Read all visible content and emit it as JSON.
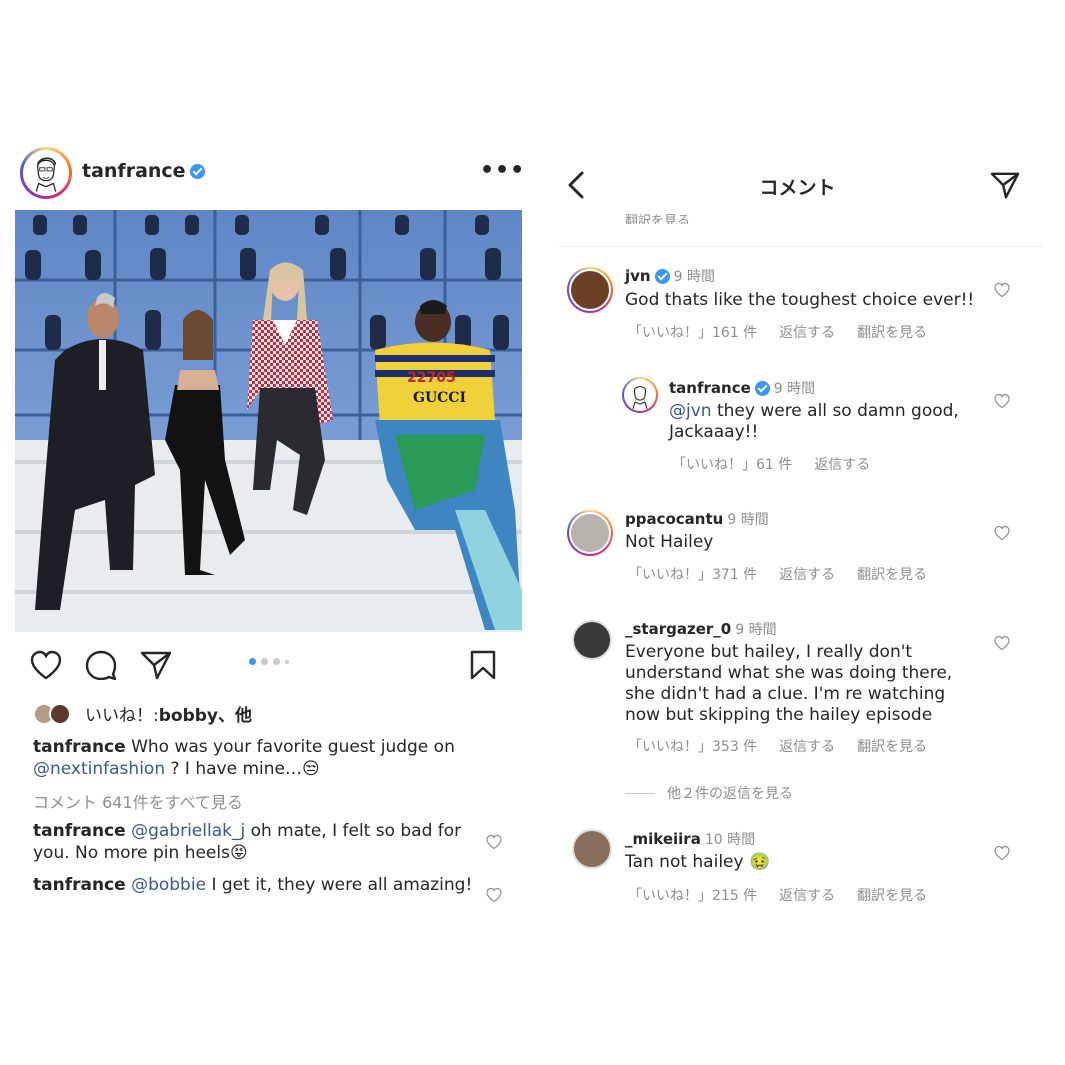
{
  "post": {
    "username": "tanfrance",
    "likes_prefix": "いいね！: ",
    "likes_label": "bobby、他",
    "caption_text": " Who was your favorite guest judge on ",
    "caption_mention": "@nextinfashion",
    "caption_tail": " ? I have mine…😒",
    "view_all": "コメント 641件をすべて見る",
    "comments": [
      {
        "user": "tanfrance",
        "mention": "@gabriellak_j",
        "text": " oh mate, I felt so bad for you. No more pin heels😝"
      },
      {
        "user": "tanfrance",
        "mention": "@bobbie",
        "text": " I get it, they were all amazing!"
      }
    ]
  },
  "comments_screen": {
    "title": "コメント",
    "truncated": "翻訳を見る",
    "more_replies": "他２件の返信を見る",
    "items": [
      {
        "user": "jvn",
        "time": "9 時間",
        "text": "God thats like the toughest choice ever!!",
        "likes": "「いいね！」161 件",
        "reply": "返信する",
        "translate": "翻訳を見る"
      },
      {
        "user": "tanfrance",
        "time": "9 時間",
        "mention": "@jvn",
        "text": " they were all so damn good, Jackaaay!!",
        "likes": "「いいね！」61 件",
        "reply": "返信する"
      },
      {
        "user": "ppacocantu",
        "time": "9 時間",
        "text": "Not Hailey",
        "likes": "「いいね！」371 件",
        "reply": "返信する",
        "translate": "翻訳を見る"
      },
      {
        "user": "_stargazer_0",
        "time": "9 時間",
        "text": "Everyone but hailey, I really don't understand what she was doing there, she didn't had a clue. I'm re watching now but skipping the  hailey episode",
        "likes": "「いいね！」353 件",
        "reply": "返信する",
        "translate": "翻訳を見る"
      },
      {
        "user": "_mikeiira",
        "time": "10 時間",
        "text": "Tan not hailey 🤢",
        "likes": "「いいね！」215 件",
        "reply": "返信する",
        "translate": "翻訳を見る"
      }
    ]
  },
  "icons": [
    "sketch-avatar-icon",
    "verified-icon",
    "more-icon",
    "heart-icon",
    "comment-icon",
    "share-icon",
    "bookmark-icon",
    "back-icon",
    "send-icon"
  ],
  "colors": {
    "verified": "#3897f0",
    "mention": "#385898",
    "muted": "#8e8e8e"
  }
}
